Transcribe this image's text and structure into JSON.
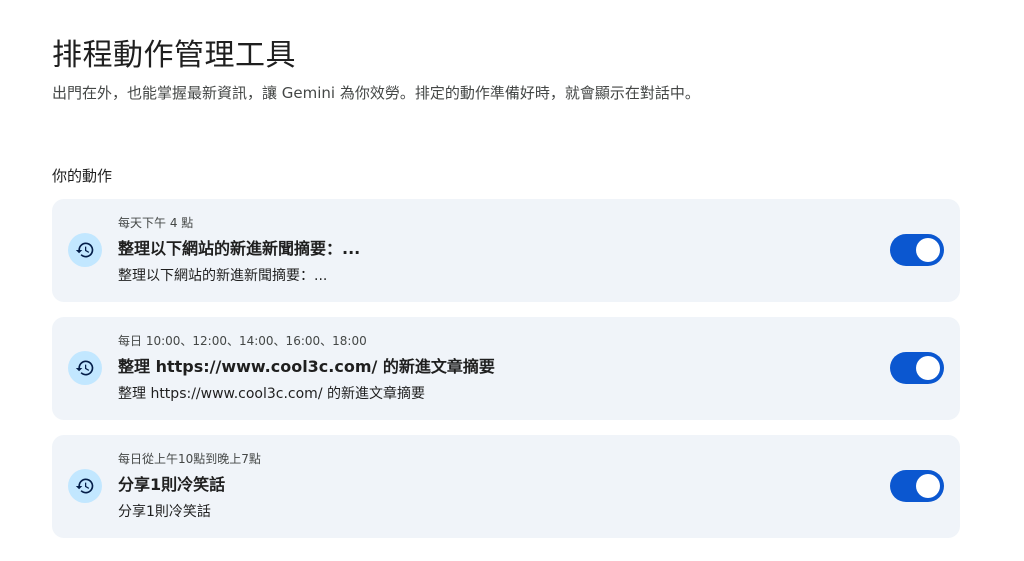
{
  "header": {
    "title": "排程動作管理工具",
    "subtitle": "出門在外，也能掌握最新資訊，讓 Gemini 為你效勞。排定的動作準備好時，就會顯示在對話中。"
  },
  "section": {
    "title": "你的動作"
  },
  "actions": [
    {
      "icon": "schedule-history-icon",
      "schedule": "每天下午 4 點",
      "title": "整理以下網站的新進新聞摘要：...",
      "description": "整理以下網站的新進新聞摘要：...",
      "enabled": true
    },
    {
      "icon": "schedule-history-icon",
      "schedule": "每日 10:00、12:00、14:00、16:00、18:00",
      "title": "整理 https://www.cool3c.com/ 的新進文章摘要",
      "description": "整理 https://www.cool3c.com/ 的新進文章摘要",
      "enabled": true
    },
    {
      "icon": "schedule-history-icon",
      "schedule": "每日從上午10點到晚上7點",
      "title": "分享1則冷笑話",
      "description": "分享1則冷笑話",
      "enabled": true
    }
  ],
  "colors": {
    "card_bg": "#f0f4f9",
    "icon_bg": "#c2e7ff",
    "icon_fg": "#041e49",
    "toggle_on": "#0b57d0"
  }
}
